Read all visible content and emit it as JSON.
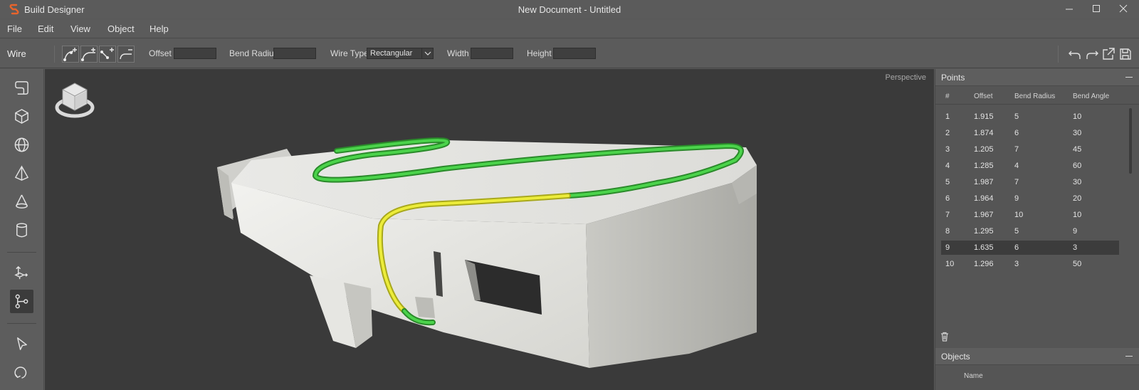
{
  "titlebar": {
    "app_name": "Build Designer",
    "document_title": "New Document - Untitled"
  },
  "menu": [
    "File",
    "Edit",
    "View",
    "Object",
    "Help"
  ],
  "toolbar": {
    "mode": "Wire",
    "tool_icons": [
      "add-point-icon",
      "add-bend-icon",
      "add-segment-icon",
      "remove-point-icon"
    ],
    "offset_label": "Offset",
    "offset_value": "",
    "bend_radius_label": "Bend Radius",
    "bend_radius_value": "",
    "wire_type_label": "Wire Type",
    "wire_type_value": "Rectangular",
    "width_label": "Width",
    "width_value": "",
    "height_label": "Height",
    "height_value": "",
    "right_icons": [
      "undo-icon",
      "redo-icon",
      "export-icon",
      "save-icon"
    ]
  },
  "left_tools": [
    "sketch-icon",
    "box-icon",
    "sphere-icon",
    "pyramid-icon",
    "cone-icon",
    "cylinder-icon",
    "transform-icon",
    "wire-icon",
    "select-icon",
    "rotate-icon"
  ],
  "viewport": {
    "projection_label": "Perspective"
  },
  "points_panel": {
    "title": "Points",
    "columns": [
      "#",
      "Offset",
      "Bend Radius",
      "Bend Angle"
    ],
    "rows": [
      [
        "1",
        "1.915",
        "5",
        "10"
      ],
      [
        "2",
        "1.874",
        "6",
        "30"
      ],
      [
        "3",
        "1.205",
        "7",
        "45"
      ],
      [
        "4",
        "1.285",
        "4",
        "60"
      ],
      [
        "5",
        "1.987",
        "7",
        "30"
      ],
      [
        "6",
        "1.964",
        "9",
        "20"
      ],
      [
        "7",
        "1.967",
        "10",
        "10"
      ],
      [
        "8",
        "1.295",
        "5",
        "9"
      ],
      [
        "9",
        "1.635",
        "6",
        "3"
      ],
      [
        "10",
        "1.296",
        "3",
        "50"
      ]
    ],
    "selected_row": "9"
  },
  "objects_panel": {
    "title": "Objects",
    "columns": [
      "Name"
    ]
  },
  "colors": {
    "wire_green": "#3fbf3f",
    "wire_yellow": "#dede2e",
    "viewport_bg": "#3a3a3a",
    "model_white": "#e8e8e4"
  }
}
